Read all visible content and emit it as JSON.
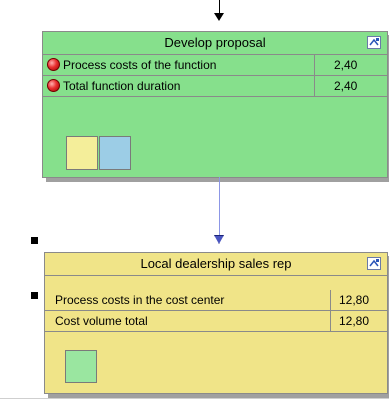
{
  "colors": {
    "function_box": "#86e08c",
    "orgunit_box": "#f0e488",
    "swatch_yellow": "#f4ee9a",
    "swatch_blue": "#9ccde6",
    "swatch_green": "#9ae6a0",
    "connector": "#8c96e6"
  },
  "function_box": {
    "title": "Develop proposal",
    "rows": [
      {
        "label": "Process costs of the function",
        "value": "2,40"
      },
      {
        "label": "Total function duration",
        "value": "2,40"
      }
    ]
  },
  "orgunit_box": {
    "title": "Local dealership sales rep",
    "rows": [
      {
        "label": "Process costs in the cost center",
        "value": "12,80"
      },
      {
        "label": "Cost volume total",
        "value": "12,80"
      }
    ]
  },
  "icons": {
    "title_icon": "model-assignment-icon",
    "arrow_top": "arrow-down-icon",
    "arrow_connector": "arrow-down-icon",
    "bullet": "red-bullet-icon"
  }
}
